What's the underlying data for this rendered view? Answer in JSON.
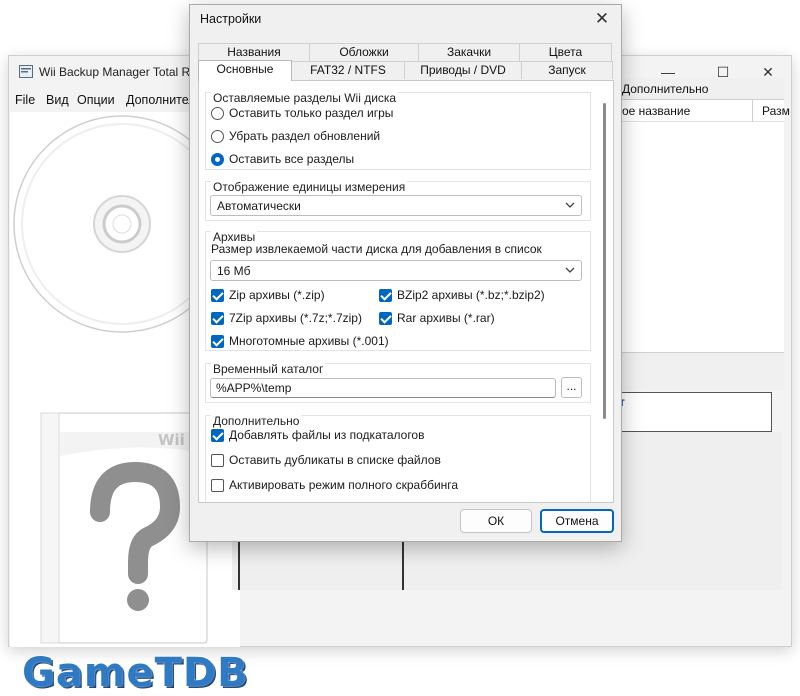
{
  "main_window": {
    "title": "Wii Backup Manager Total RU",
    "controls": {
      "minimize": "—",
      "maximize": "☐",
      "close": "✕"
    },
    "menu": [
      "File",
      "Вид",
      "Опции",
      "Дополнительно"
    ],
    "grid_header": "Дополнительно",
    "columns": [
      "ое название",
      "Разм"
    ],
    "lower_link": "т",
    "cover_text": "Wii",
    "logo_text": "GameTDB"
  },
  "dialog": {
    "title": "Настройки",
    "close_glyph": "✕",
    "tabs_back": [
      "Названия",
      "Обложки",
      "Закачки",
      "Цвета"
    ],
    "tabs_front": [
      "Основные",
      "FAT32 / NTFS",
      "Приводы / DVD",
      "Запуск"
    ],
    "active_tab": "Основные",
    "partitions": {
      "title": "Оставляемые разделы Wii диска",
      "options": [
        {
          "label": "Оставить только раздел игры",
          "checked": false
        },
        {
          "label": "Убрать раздел обновлений",
          "checked": false
        },
        {
          "label": "Оставить все разделы",
          "checked": true
        }
      ]
    },
    "units": {
      "title": "Отображение единицы измерения",
      "value": "Автоматически"
    },
    "archives": {
      "title": "Архивы",
      "size_label": "Размер извлекаемой части диска для добавления в список",
      "size_value": "16 Мб",
      "formats": [
        {
          "label": "Zip архивы (*.zip)",
          "checked": true
        },
        {
          "label": "BZip2 архивы (*.bz;*.bzip2)",
          "checked": true
        },
        {
          "label": "7Zip архивы (*.7z;*.7zip)",
          "checked": true
        },
        {
          "label": "Rar архивы (*.rar)",
          "checked": true
        },
        {
          "label": "Многотомные архивы (*.001)",
          "checked": true
        }
      ]
    },
    "temp": {
      "title": "Временный каталог",
      "value": "%APP%\\temp",
      "browse_label": "..."
    },
    "extra": {
      "title": "Дополнительно",
      "options": [
        {
          "label": "Добавлять файлы из подкаталогов",
          "checked": true
        },
        {
          "label": "Оставить дубликаты в списке файлов",
          "checked": false
        },
        {
          "label": "Активировать режим полного скраббинга",
          "checked": false
        }
      ]
    },
    "ok_label": "ОК",
    "cancel_label": "Отмена"
  },
  "colors": {
    "accent": "#0067c0",
    "logo": "#2f7ac4"
  },
  "icons": [
    "app-icon",
    "disc-icon",
    "question-mark-icon",
    "chevron-down-icon",
    "close-icon"
  ]
}
